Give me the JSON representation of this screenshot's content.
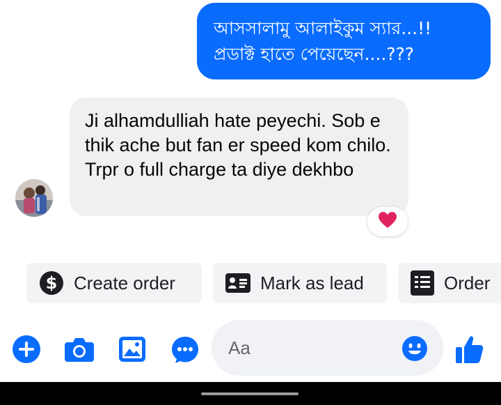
{
  "messages": {
    "outgoing": {
      "lines": [
        "আসসালামু আলাইকুম স্যার...!!",
        "প্রডাক্ট হাতে পেয়েছেন....???"
      ]
    },
    "incoming": {
      "text": "Ji alhamdulliah hate peyechi. Sob e thik ache but fan er speed kom chilo. Trpr o full charge ta diye dekhbo",
      "reaction": "heart-icon"
    }
  },
  "actions": [
    {
      "label": "Create order",
      "icon": "dollar-icon"
    },
    {
      "label": "Mark as lead",
      "icon": "id-card-icon"
    },
    {
      "label": "Order",
      "icon": "receipt-icon"
    }
  ],
  "composer": {
    "placeholder": "Aa",
    "icons": [
      "plus-icon",
      "camera-icon",
      "image-icon",
      "chat-more-icon",
      "emoji-icon",
      "thumbs-up-icon"
    ]
  },
  "colors": {
    "accent": "#0a6cff",
    "incoming_bubble": "#f0f0f0",
    "chip_bg": "#f2f3f5",
    "reaction": "#e0245e"
  }
}
